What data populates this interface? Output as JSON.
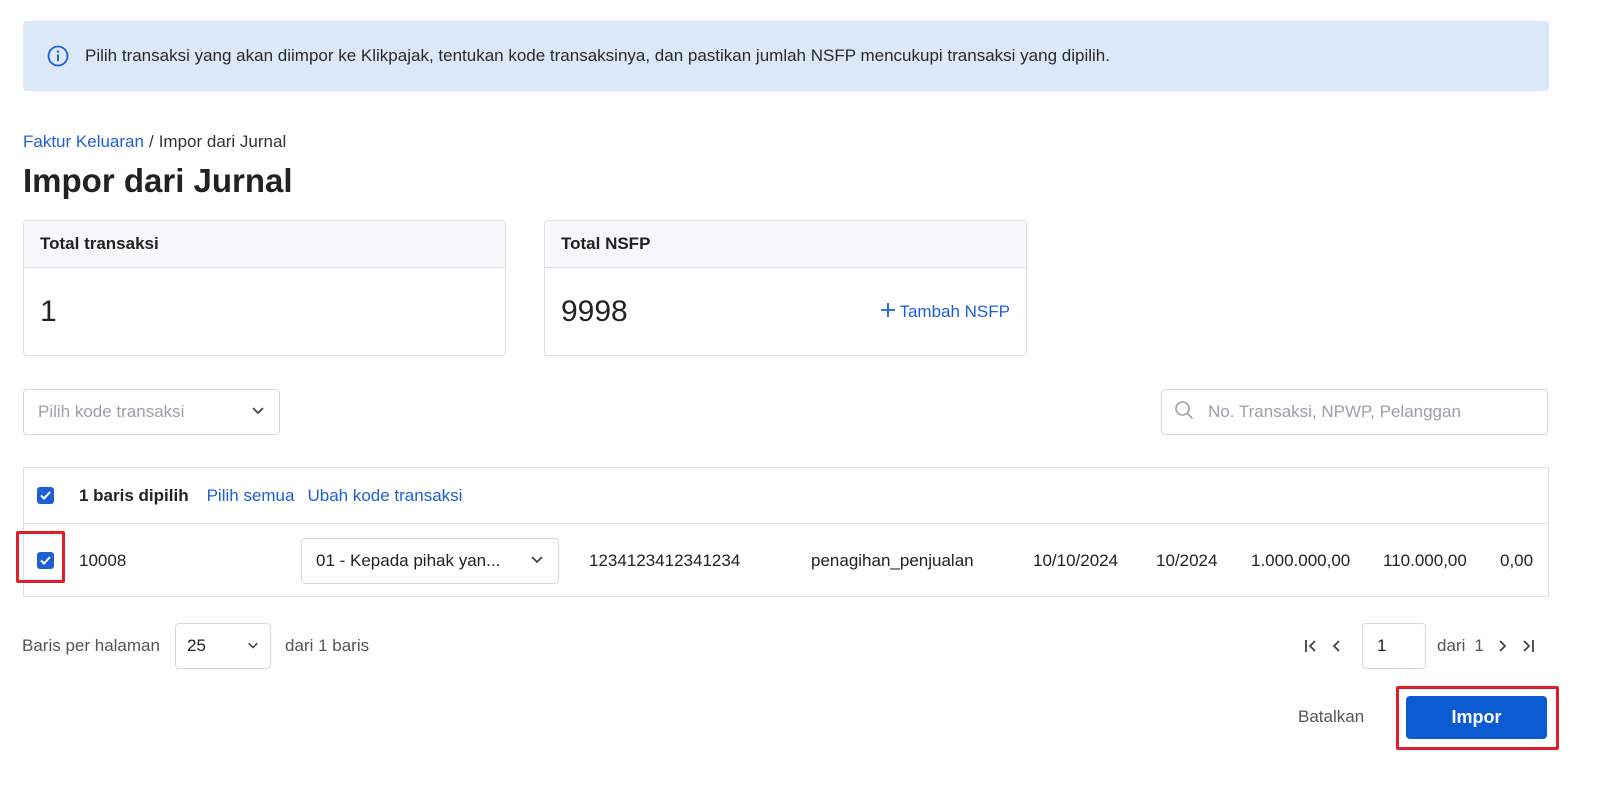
{
  "banner": {
    "text": "Pilih transaksi yang akan diimpor ke Klikpajak, tentukan kode transaksinya, dan pastikan jumlah NSFP mencukupi transaksi yang dipilih."
  },
  "breadcrumb": {
    "parent": "Faktur Keluaran",
    "separator": "/",
    "current": "Impor dari Jurnal"
  },
  "page_title": "Impor dari Jurnal",
  "stats": {
    "total_transactions": {
      "label": "Total transaksi",
      "value": "1"
    },
    "total_nsfp": {
      "label": "Total NSFP",
      "value": "9998",
      "action": "Tambah NSFP"
    }
  },
  "filters": {
    "transaction_code_placeholder": "Pilih kode transaksi",
    "search_placeholder": "No. Transaksi, NPWP, Pelanggan"
  },
  "selection_bar": {
    "count_text": "1 baris dipilih",
    "select_all": "Pilih semua",
    "change_code": "Ubah kode transaksi"
  },
  "rows": [
    {
      "checked": true,
      "transaction_no": "10008",
      "transaction_code": "01 - Kepada pihak yan...",
      "npwp": "1234123412341234",
      "type": "penagihan_penjualan",
      "date": "10/10/2024",
      "period": "10/2024",
      "dpp": "1.000.000,00",
      "ppn": "110.000,00",
      "ppnbm": "0,00"
    }
  ],
  "pagination": {
    "rows_per_page_label": "Baris per halaman",
    "rows_per_page": "25",
    "of_rows": "dari 1 baris",
    "current_page": "1",
    "of_label": "dari",
    "total_pages": "1"
  },
  "actions": {
    "cancel": "Batalkan",
    "import": "Impor"
  },
  "colors": {
    "accent": "#1f5fd6",
    "primary_button": "#0b5bd3",
    "banner_bg": "#dbe8f7",
    "highlight": "#e21d2a"
  }
}
